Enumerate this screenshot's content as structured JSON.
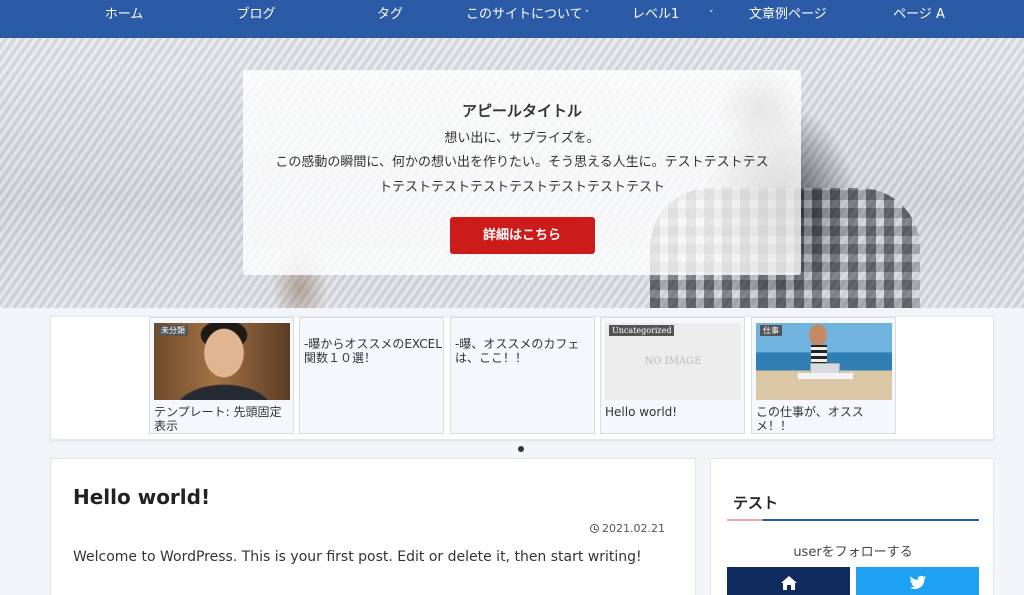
{
  "nav": {
    "items": [
      {
        "label": "ホーム",
        "dropdown": false
      },
      {
        "label": "ブログ",
        "dropdown": false
      },
      {
        "label": "タグ",
        "dropdown": false
      },
      {
        "label": "このサイトについて",
        "dropdown": true
      },
      {
        "label": "レベル1",
        "dropdown": true
      },
      {
        "label": "文章例ページ",
        "dropdown": false
      },
      {
        "label": "ページ A",
        "dropdown": false
      }
    ],
    "chevron": "˅"
  },
  "hero": {
    "title": "アピールタイトル",
    "subtitle": "想い出に、サプライズを。",
    "text": "この感動の瞬間に、何かの想い出を作りたい。そう思える人生に。テストテストテストテストテストテストテストテストテストテスト",
    "button_label": "詳細はこちら"
  },
  "carousel": {
    "cards": [
      {
        "badge": "未分類",
        "title": "テンプレート: 先頭固定表示",
        "thumb": "portrait-man"
      },
      {
        "badge": "",
        "title": "-曝からオススメのEXCEL関数１０選！",
        "thumb": "none"
      },
      {
        "badge": "",
        "title": "-曝、オススメのカフェは、ここ！！",
        "thumb": "none"
      },
      {
        "badge": "Uncategorized",
        "title": "Hello world!",
        "thumb": "no-image",
        "thumb_text": "NO IMAGE"
      },
      {
        "badge": "仕事",
        "title": "この仕事が、オススメ！！",
        "thumb": "beach-laptop"
      }
    ]
  },
  "post": {
    "title": "Hello world!",
    "date": "2021.02.21",
    "excerpt": "Welcome to WordPress. This is your first post. Edit or delete it, then start writing!"
  },
  "sidebar": {
    "widget_title": "テスト",
    "follow_text": "userをフォローする",
    "colors": {
      "home": "#0f2a5c",
      "twitter": "#1ea1f2",
      "rule_accent": "#e7a9b8",
      "rule_main": "#2a5aa6"
    }
  },
  "colors": {
    "nav": "#2b5aa6",
    "cta": "#cc1b1b"
  }
}
